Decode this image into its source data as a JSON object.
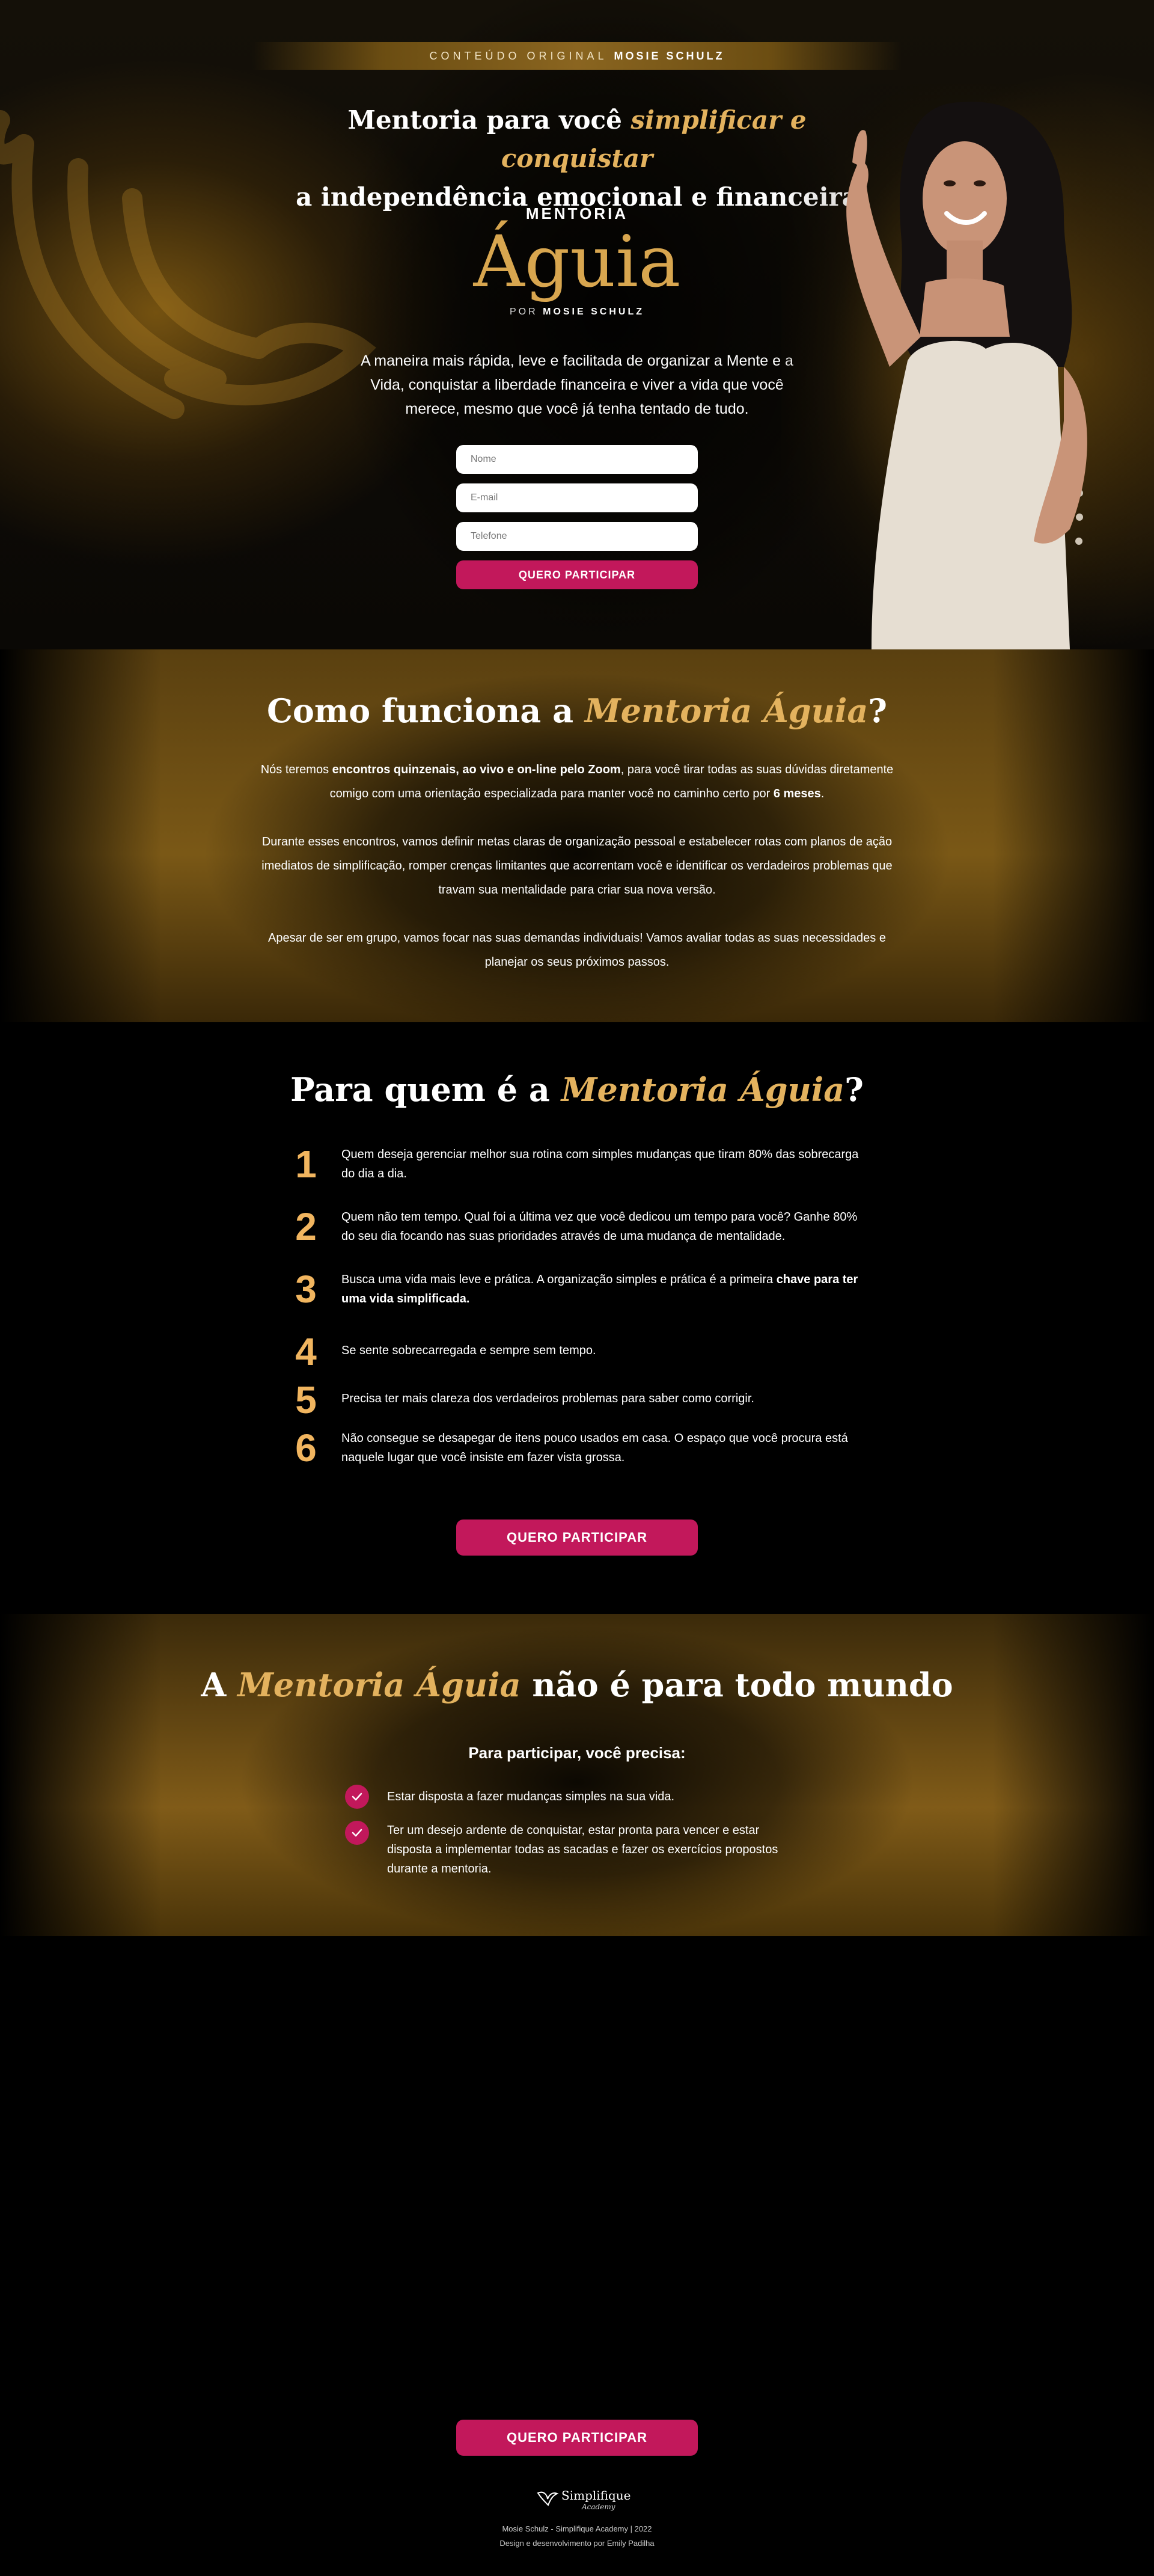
{
  "hero": {
    "banner_prefix": "CONTEÚDO ORIGINAL",
    "banner_name": "MOSIE SCHULZ",
    "title_part1": "Mentoria para você ",
    "title_highlight": "simplificar e conquistar",
    "title_line2": "a independência emocional e financeira",
    "logo_top": "MENTORIA",
    "logo_main": "Águia",
    "logo_by_prefix": "POR",
    "logo_by_name": "MOSIE SCHULZ",
    "description": "A maneira mais rápida, leve e facilitada de organizar a Mente e a Vida, conquistar a liberdade financeira e viver a vida que você merece, mesmo que você já tenha tentado de tudo.",
    "form": {
      "name_placeholder": "Nome",
      "email_placeholder": "E-mail",
      "phone_placeholder": "Telefone",
      "submit_label": "QUERO PARTICIPAR"
    }
  },
  "how": {
    "title_prefix": "Como funciona a ",
    "title_highlight": "Mentoria Águia",
    "title_suffix": "?",
    "p1_a": "Nós teremos ",
    "p1_b": "encontros quinzenais, ao vivo e on-line pelo Zoom",
    "p1_c": ", para você tirar todas as suas dúvidas diretamente comigo com uma orientação especializada para manter você no caminho certo por ",
    "p1_d": "6 meses",
    "p1_e": ".",
    "p2": "Durante esses encontros, vamos definir metas claras de organização pessoal e estabelecer rotas com planos de ação imediatos de simplificação, romper crenças limitantes que acorrentam você e identificar os verdadeiros problemas que travam sua mentalidade para criar sua nova versão.",
    "p3": "Apesar de ser em grupo, vamos focar nas suas demandas individuais! Vamos avaliar todas as suas necessidades e planejar os seus próximos passos."
  },
  "who": {
    "title_prefix": "Para quem é a ",
    "title_highlight": "Mentoria Águia",
    "title_suffix": "?",
    "items": [
      {
        "num": "1",
        "text": "Quem deseja gerenciar melhor sua rotina com simples mudanças que tiram 80% das sobrecarga do dia a dia."
      },
      {
        "num": "2",
        "text": "Quem não tem tempo. Qual foi a última vez que você dedicou um tempo para você? Ganhe 80% do seu dia focando nas suas prioridades através de uma mudança de mentalidade."
      },
      {
        "num": "3",
        "text": "Busca uma vida mais leve e prática. A organização simples e prática é a primeira ",
        "bold": "chave para ter uma vida simplificada."
      },
      {
        "num": "4",
        "text": "Se sente sobrecarregada e sempre sem tempo."
      },
      {
        "num": "5",
        "text": "Precisa ter mais clareza dos verdadeiros problemas para saber como corrigir."
      },
      {
        "num": "6",
        "text": "Não consegue se desapegar de itens pouco usados em casa. O espaço que você procura está naquele lugar que você insiste em fazer vista grossa."
      }
    ],
    "cta": "QUERO PARTICIPAR"
  },
  "notall": {
    "title_a": "A ",
    "title_highlight": "Mentoria Águia",
    "title_bold": " não",
    "title_suffix": " é para todo mundo",
    "need_title": "Para participar, você precisa:",
    "needs": [
      "Estar disposta a fazer mudanças simples na sua vida.",
      "Ter um desejo ardente de conquistar, estar pronta para vencer e estar disposta a implementar todas as sacadas e fazer os exercícios propostos durante a mentoria."
    ]
  },
  "bottom": {
    "cta": "QUERO PARTICIPAR",
    "logo_text": "Simplifique",
    "logo_sub": "Academy",
    "footer1": "Mosie Schulz - Simplifique Academy | 2022",
    "footer2": "Design e desenvolvimento por Emily Padilha"
  },
  "colors": {
    "gold": "#e3b25e",
    "number": "#f1b55f",
    "cta": "#c2185b"
  }
}
